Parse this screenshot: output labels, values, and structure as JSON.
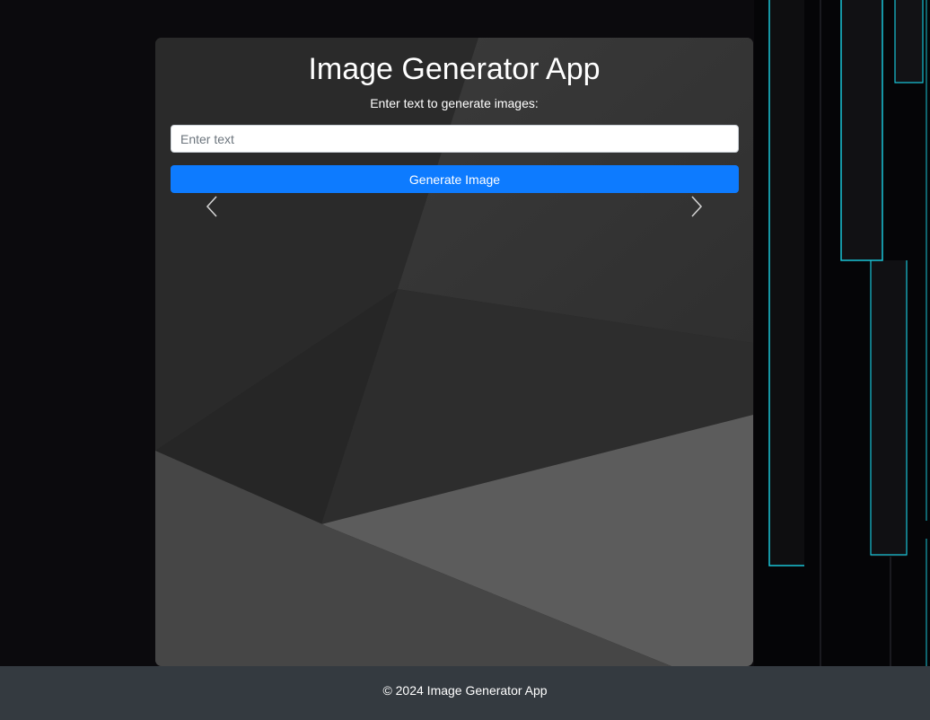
{
  "app": {
    "title": "Image Generator App",
    "subtitle": "Enter text to generate images:"
  },
  "input": {
    "placeholder": "Enter text",
    "value": ""
  },
  "generate_button": {
    "label": "Generate Image"
  },
  "carousel": {
    "prev_icon": "chevron-left-icon",
    "next_icon": "chevron-right-icon"
  },
  "footer": {
    "text": "© 2024 Image Generator App"
  },
  "colors": {
    "primary": "#0d7bff",
    "footer_bg": "#343a40",
    "page_bg": "#0b0a0d",
    "neon_accent": "#19c3d6"
  }
}
